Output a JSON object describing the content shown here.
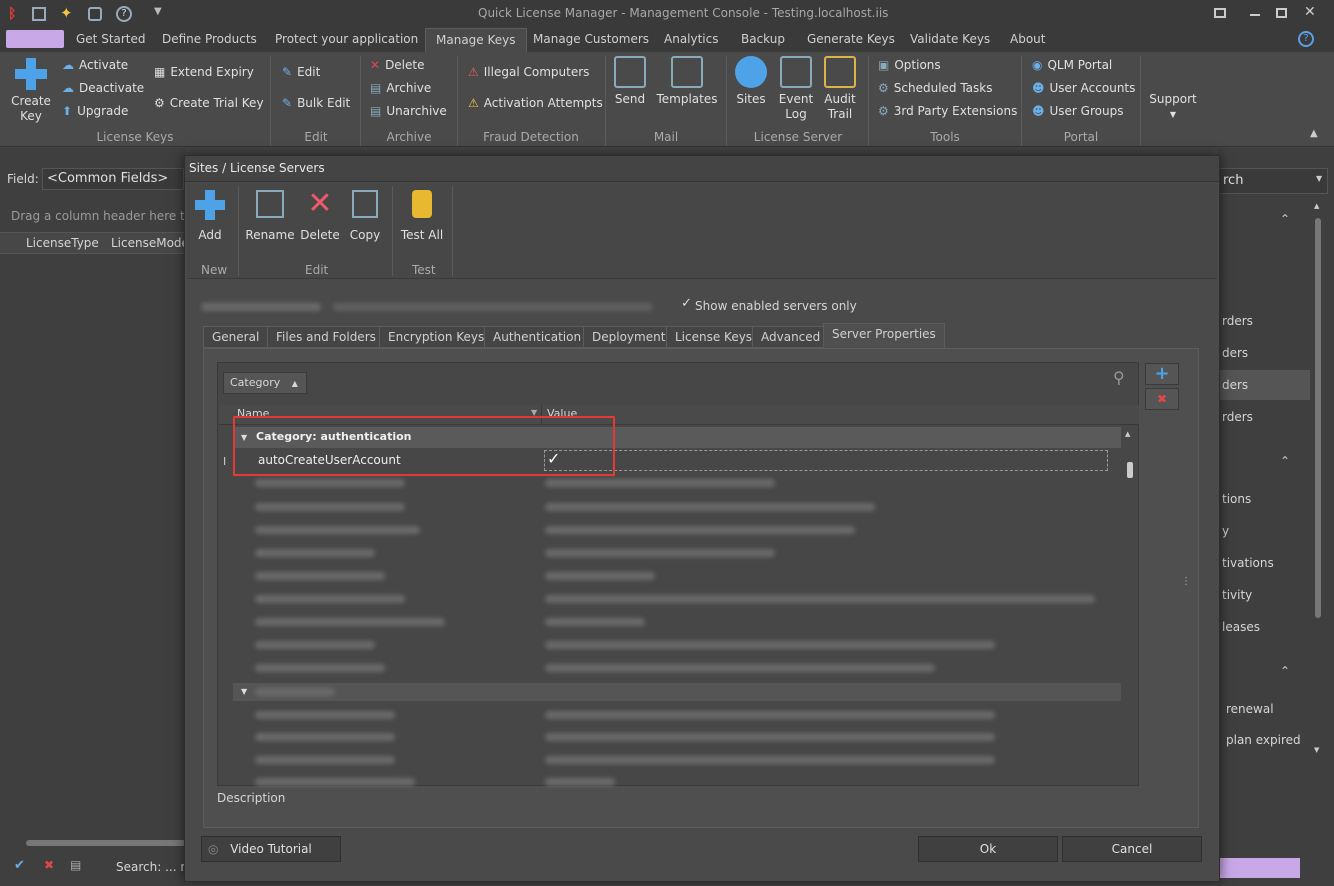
{
  "window": {
    "title": "Quick License Manager - Management Console - Testing.localhost.iis"
  },
  "menu_tabs": [
    "Get Started",
    "Define Products",
    "Protect your application",
    "Manage Keys",
    "Manage Customers",
    "Analytics",
    "Backup",
    "Generate Keys",
    "Validate Keys",
    "About"
  ],
  "ribbon": {
    "create_key": "Create\nKey",
    "activate": "Activate",
    "deactivate": "Deactivate",
    "upgrade": "Upgrade",
    "extend_expiry": "Extend Expiry",
    "create_trial_key": "Create Trial Key",
    "edit": "Edit",
    "bulk_edit": "Bulk Edit",
    "delete": "Delete",
    "archive": "Archive",
    "unarchive": "Unarchive",
    "illegal_computers": "Illegal Computers",
    "activation_attempts": "Activation Attempts",
    "send": "Send",
    "templates": "Templates",
    "sites": "Sites",
    "event_log": "Event\nLog",
    "audit_trail": "Audit\nTrail",
    "options": "Options",
    "scheduled_tasks": "Scheduled Tasks",
    "third_party": "3rd Party Extensions",
    "qlm_portal": "QLM Portal",
    "user_accounts": "User Accounts",
    "user_groups": "User Groups",
    "support": "Support",
    "groups": {
      "license_keys": "License Keys",
      "edit": "Edit",
      "archive": "Archive",
      "fraud": "Fraud Detection",
      "mail": "Mail",
      "license_server": "License Server",
      "tools": "Tools",
      "portal": "Portal"
    }
  },
  "left_panel": {
    "field_label": "Field:",
    "field_value": "<Common Fields>",
    "drag_hint": "Drag a column header here to g",
    "col1": "LicenseType",
    "col2": "LicenseMode",
    "search_status": "Search: ... no"
  },
  "right_panel": {
    "search_fragment": "rch",
    "links": [
      "rders",
      "ders",
      "ders",
      "rders",
      "tions",
      "y",
      "tivations",
      "tivity",
      "leases",
      "renewal",
      "plan expired"
    ]
  },
  "dialog": {
    "title": "Sites / License Servers",
    "toolbar": {
      "add": "Add",
      "rename": "Rename",
      "delete": "Delete",
      "copy": "Copy",
      "test_all": "Test All",
      "group_new": "New",
      "group_edit": "Edit",
      "group_test": "Test"
    },
    "show_enabled": "Show enabled servers only",
    "tabs": [
      "General",
      "Files and Folders",
      "Encryption Keys",
      "Authentication",
      "Deployment",
      "License Keys",
      "Advanced",
      "Server Properties"
    ],
    "grid": {
      "group_by": "Category",
      "col_name": "Name",
      "col_value": "Value",
      "category_row": "Category: authentication",
      "first_row_name": "autoCreateUserAccount",
      "first_row_value": "✓"
    },
    "description_label": "Description",
    "video_tutorial": "Video Tutorial",
    "ok": "Ok",
    "cancel": "Cancel"
  }
}
